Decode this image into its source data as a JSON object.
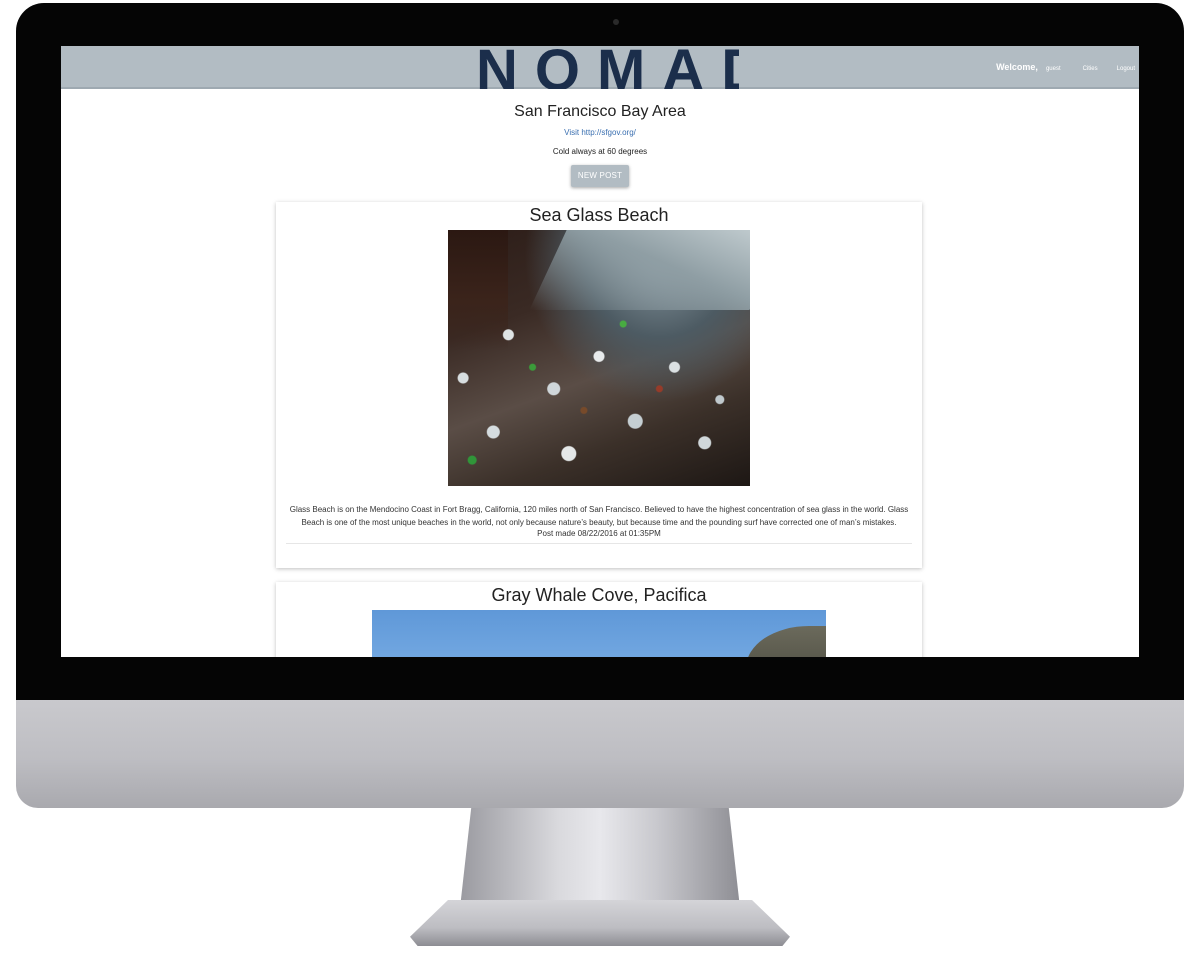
{
  "app": {
    "logo_text": "NOMAD"
  },
  "nav": {
    "welcome_label": "Welcome,",
    "username": "guest",
    "cities_label": "Cities",
    "logout_label": "Logout"
  },
  "city": {
    "title": "San Francisco Bay Area",
    "link_text": "Visit http://sfgov.org/",
    "description": "Cold always at 60 degrees",
    "new_post_label": "NEW POST"
  },
  "posts": [
    {
      "title": "Sea Glass Beach",
      "body": "Glass Beach is on the Mendocino Coast in Fort Bragg, California, 120 miles north of San Francisco. Believed to have the highest concentration of sea glass in the world. Glass Beach is one of the most unique beaches in the world, not only because nature’s beauty, but because time and the pounding surf have corrected one of man’s mistakes.",
      "meta": "Post made 08/22/2016 at 01:35PM"
    },
    {
      "title": "Gray Whale Cove, Pacifica"
    }
  ],
  "colors": {
    "topbar": "#b2bcc3",
    "logo": "#1b2e4b",
    "link": "#3a6fb0",
    "button": "#b2bcc3"
  }
}
